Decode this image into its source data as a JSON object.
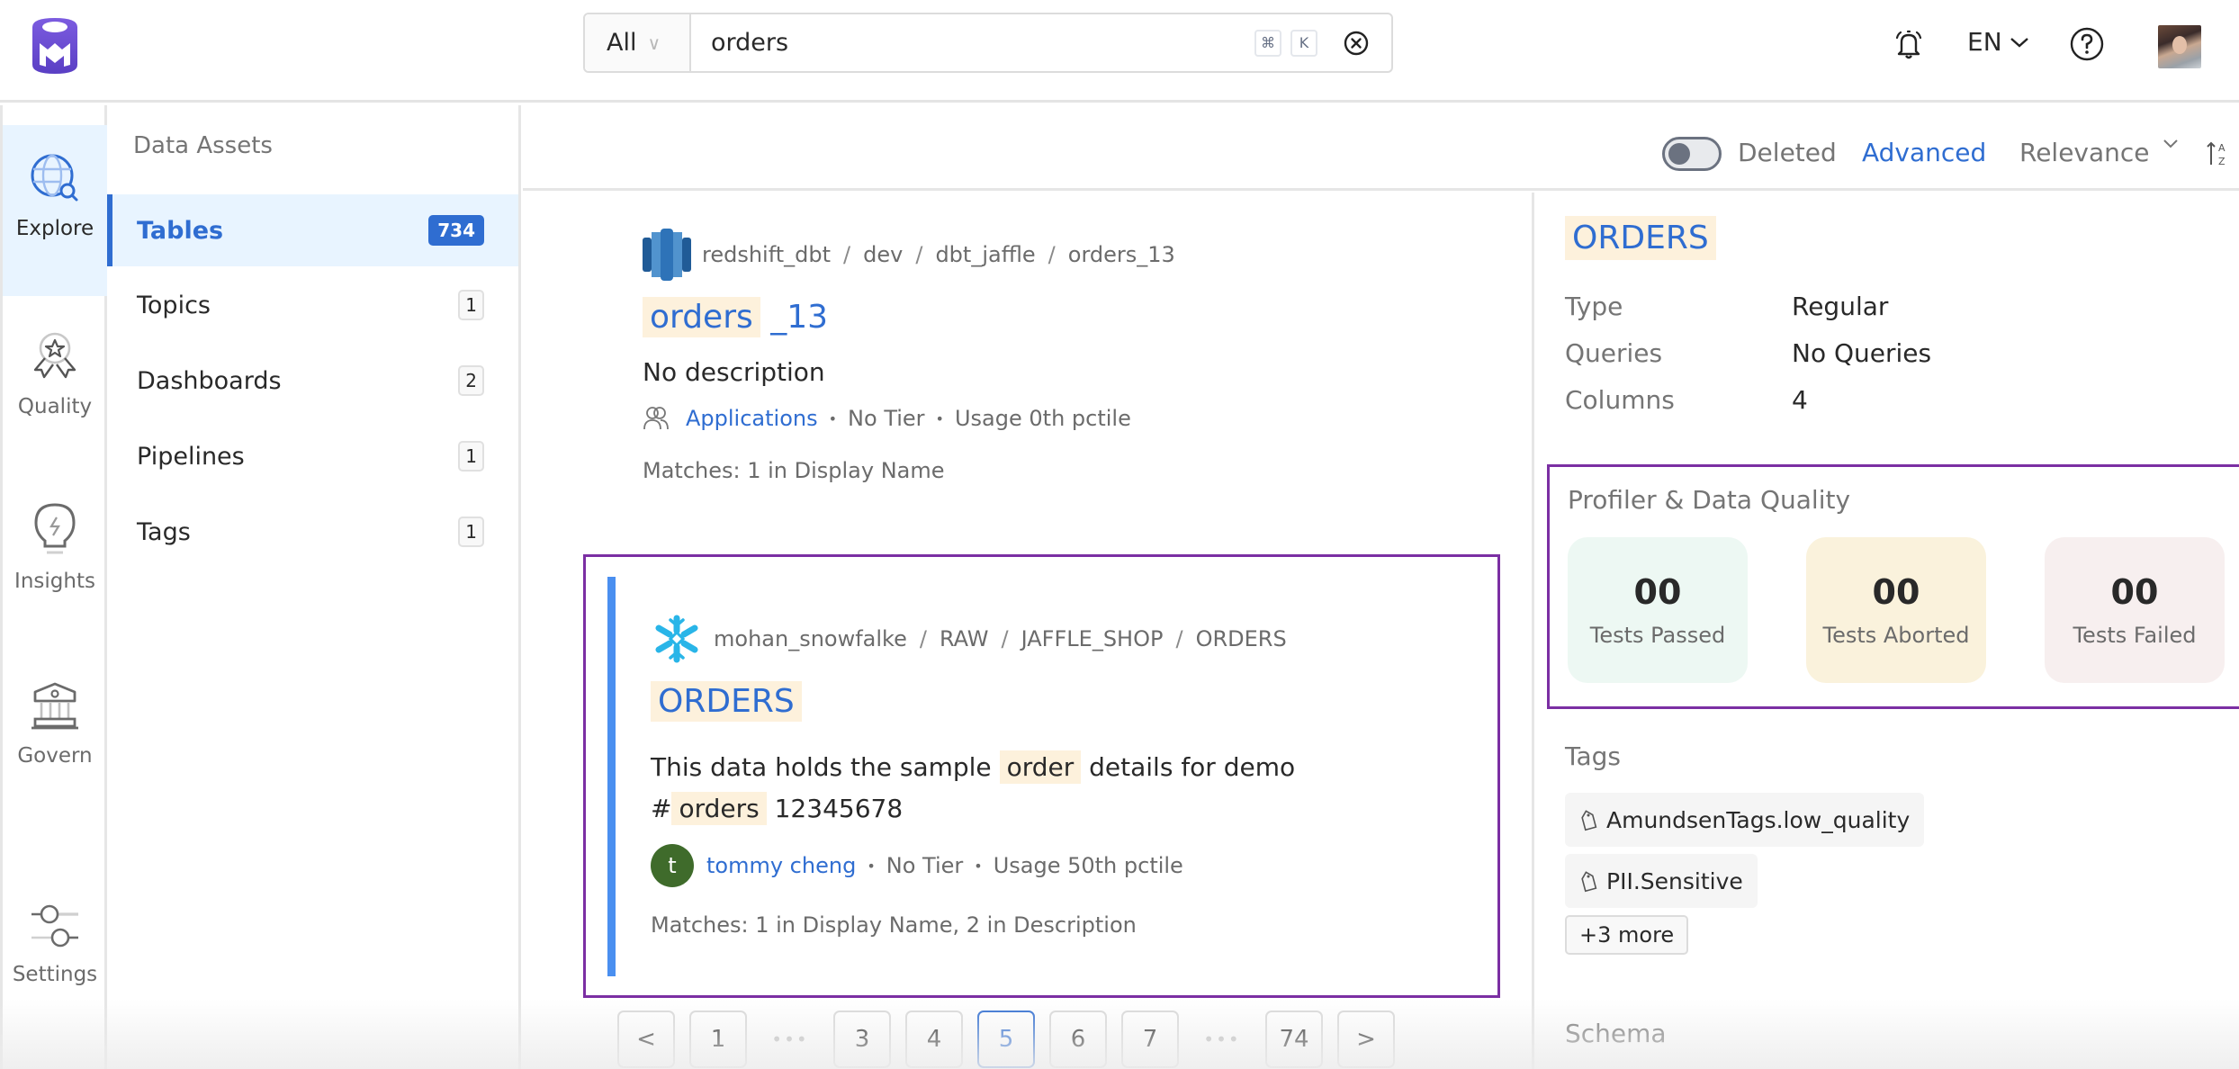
{
  "header": {
    "logo": "openmetadata-logo",
    "search": {
      "scope": "All",
      "value": "orders",
      "placeholder": "",
      "shortcut_keys": [
        "⌘",
        "K"
      ]
    },
    "language": "EN",
    "icons": [
      "bell-icon",
      "help-icon",
      "user-avatar"
    ]
  },
  "leftnav": {
    "items": [
      {
        "label": "Explore",
        "icon": "globe-search-icon",
        "active": true
      },
      {
        "label": "Quality",
        "icon": "award-ribbon-icon",
        "active": false
      },
      {
        "label": "Insights",
        "icon": "lightbulb-icon",
        "active": false
      },
      {
        "label": "Govern",
        "icon": "bank-building-icon",
        "active": false
      },
      {
        "label": "Settings",
        "icon": "sliders-icon",
        "active": false
      }
    ]
  },
  "categories": {
    "title": "Data Assets",
    "items": [
      {
        "label": "Tables",
        "count": "734",
        "active": true
      },
      {
        "label": "Topics",
        "count": "1",
        "active": false
      },
      {
        "label": "Dashboards",
        "count": "2",
        "active": false
      },
      {
        "label": "Pipelines",
        "count": "1",
        "active": false
      },
      {
        "label": "Tags",
        "count": "1",
        "active": false
      }
    ]
  },
  "toolbar": {
    "deleted_label": "Deleted",
    "deleted_toggle_on": false,
    "advanced_label": "Advanced",
    "sort_label": "Relevance",
    "sort_order_icon": "sort-ascending-az-icon"
  },
  "results": [
    {
      "service_icon": "redshift-icon",
      "breadcrumbs": [
        "redshift_dbt",
        "dev",
        "dbt_jaffle",
        "orders_13"
      ],
      "title_highlight": "orders",
      "title_rest": " _13",
      "description": "No description",
      "owner": "Applications",
      "owner_icon": "team-icon",
      "tier": "No Tier",
      "usage": "Usage 0th pctile",
      "matches": "Matches:  1 in Display Name"
    },
    {
      "service_icon": "snowflake-icon",
      "breadcrumbs": [
        "mohan_snowfalke",
        "RAW",
        "JAFFLE_SHOP",
        "ORDERS"
      ],
      "title_highlight": "ORDERS",
      "desc_before": "This data holds the sample ",
      "desc_hl1": "order",
      "desc_mid": " details for demo",
      "desc_line2_prefix": "#",
      "desc_hl2": "orders",
      "desc_after": " 12345678",
      "owner_initial": "t",
      "owner": "tommy cheng",
      "tier": "No Tier",
      "usage": "Usage 50th pctile",
      "matches": "Matches:  1 in Display Name,  2 in Description",
      "selected": true
    }
  ],
  "pagination": {
    "prev": "<",
    "next": ">",
    "pages": [
      "1",
      "…",
      "3",
      "4",
      "5",
      "6",
      "7",
      "…",
      "74"
    ],
    "current": "5"
  },
  "details": {
    "title": "ORDERS",
    "rows": [
      {
        "key": "Type",
        "value": "Regular"
      },
      {
        "key": "Queries",
        "value": "No Queries"
      },
      {
        "key": "Columns",
        "value": "4"
      }
    ],
    "profiler": {
      "title": "Profiler & Data Quality",
      "stats": [
        {
          "value": "00",
          "label": "Tests Passed",
          "color": "#edf8f3"
        },
        {
          "value": "00",
          "label": "Tests Aborted",
          "color": "#faf2dc"
        },
        {
          "value": "00",
          "label": "Tests Failed",
          "color": "#f7efef"
        }
      ]
    },
    "tags_title": "Tags",
    "tags": [
      "AmundsenTags.low_quality",
      "PII.Sensitive"
    ],
    "more_tags": "+3 more",
    "schema_title": "Schema"
  },
  "colors": {
    "accent": "#2f6dd1",
    "highlight": "#fdf1dc",
    "selection_outline": "#7b2fa3",
    "card_bar": "#4a8ff0"
  }
}
